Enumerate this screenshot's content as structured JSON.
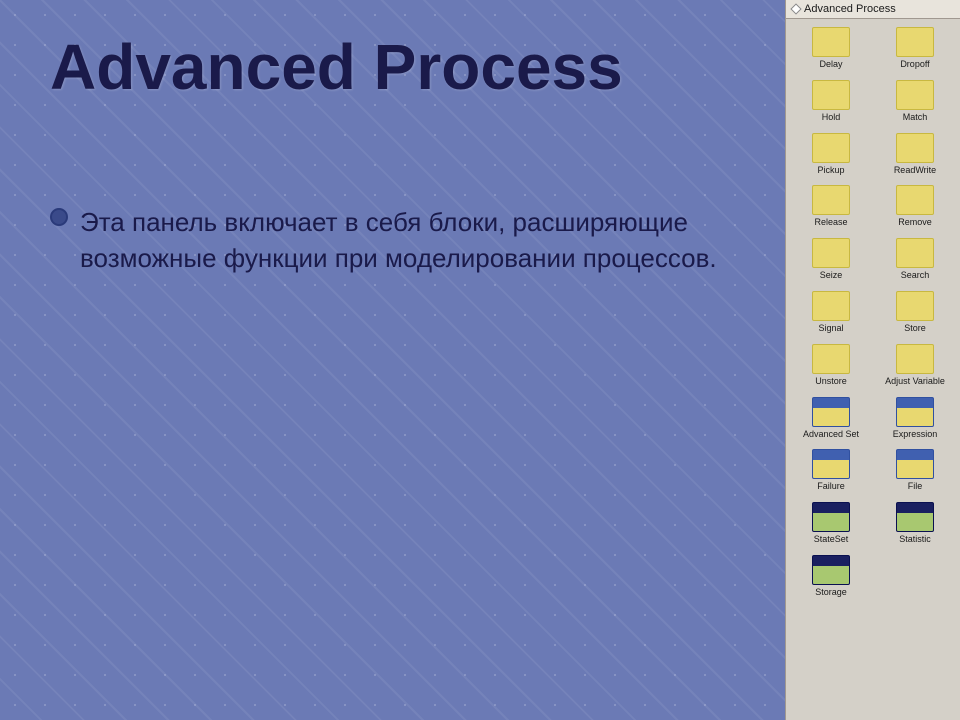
{
  "background": {
    "color": "#6b7ab5"
  },
  "title": "Advanced Process",
  "bullet_text": "Эта панель включает в себя блоки, расширяющие возможные функции при моделировании процессов.",
  "panel": {
    "title": "Advanced Process",
    "items": [
      {
        "label": "Delay",
        "icon_type": "yellow"
      },
      {
        "label": "Dropoff",
        "icon_type": "yellow"
      },
      {
        "label": "Hold",
        "icon_type": "yellow"
      },
      {
        "label": "Match",
        "icon_type": "yellow"
      },
      {
        "label": "Pickup",
        "icon_type": "yellow"
      },
      {
        "label": "ReadWrite",
        "icon_type": "yellow"
      },
      {
        "label": "Release",
        "icon_type": "yellow"
      },
      {
        "label": "Remove",
        "icon_type": "yellow"
      },
      {
        "label": "Seize",
        "icon_type": "yellow"
      },
      {
        "label": "Search",
        "icon_type": "yellow"
      },
      {
        "label": "Signal",
        "icon_type": "yellow"
      },
      {
        "label": "Store",
        "icon_type": "yellow"
      },
      {
        "label": "Unstore",
        "icon_type": "yellow"
      },
      {
        "label": "Adjust Variable",
        "icon_type": "yellow"
      },
      {
        "label": "Advanced Set",
        "icon_type": "blue_header"
      },
      {
        "label": "Expression",
        "icon_type": "blue_header"
      },
      {
        "label": "Failure",
        "icon_type": "blue_header"
      },
      {
        "label": "File",
        "icon_type": "blue_header"
      },
      {
        "label": "StateSet",
        "icon_type": "dark_header"
      },
      {
        "label": "Statistic",
        "icon_type": "dark_header"
      },
      {
        "label": "Storage",
        "icon_type": "dark_header"
      }
    ]
  }
}
